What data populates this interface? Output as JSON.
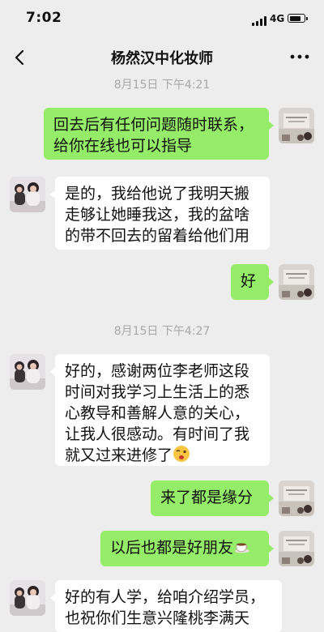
{
  "status": {
    "time": "7:02",
    "network": "4G",
    "battery_level": 0.85
  },
  "header": {
    "title": "杨然汉中化妆师",
    "back_icon": "chevron-left-icon",
    "more_icon": "more-icon"
  },
  "colors": {
    "my_bubble": "#95ec69",
    "their_bubble": "#ffffff",
    "background": "#ededed",
    "timestamp": "#a7a7a7"
  },
  "chat": {
    "timestamps": [
      "8月15日 下午4:21",
      "8月15日 下午4:27"
    ],
    "messages": [
      {
        "sender": "me",
        "text": "回去后有任何问题随时联系，给你在线也可以指导"
      },
      {
        "sender": "them",
        "text": "是的，我给他说了我明天搬走够让她睡我这，我的盆啥的带不回去的留着给他们用"
      },
      {
        "sender": "me",
        "text": "好"
      },
      {
        "sender": "them",
        "text": "好的，感谢两位李老师这段时间对我学习上生活上的悉心教导和善解人意的关心，让我人很感动。有时间了我就又过来进修了",
        "emoji": "wink-emoji"
      },
      {
        "sender": "me",
        "text": "来了都是缘分"
      },
      {
        "sender": "me",
        "text": "以后也都是好朋友",
        "emoji": "coffee-emoji"
      },
      {
        "sender": "them",
        "text": "好的有人学，给咱介绍学员，也祝你们生意兴隆桃李满天"
      }
    ]
  }
}
